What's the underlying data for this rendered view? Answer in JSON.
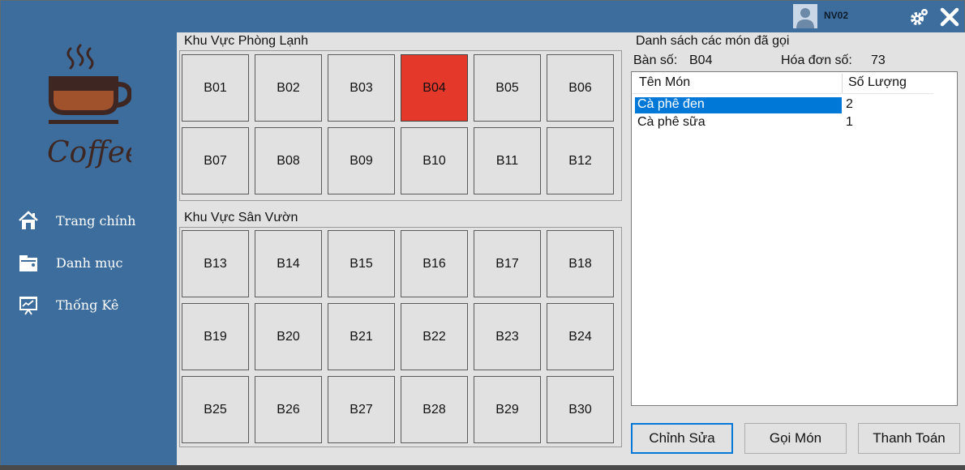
{
  "header": {
    "user_name": "NV02",
    "icons": [
      "user-avatar-icon",
      "settings-gears-icon",
      "close-icon"
    ]
  },
  "sidebar": {
    "logo_text": "Coffee",
    "items": [
      {
        "label": "Trang chính",
        "icon": "home-icon"
      },
      {
        "label": "Danh mục",
        "icon": "folder-icon"
      },
      {
        "label": "Thống Kê",
        "icon": "presentation-chart-icon"
      }
    ]
  },
  "areas": [
    {
      "title": "Khu Vực Phòng Lạnh",
      "tables": [
        "B01",
        "B02",
        "B03",
        "B04",
        "B05",
        "B06",
        "B07",
        "B08",
        "B09",
        "B10",
        "B11",
        "B12"
      ]
    },
    {
      "title": "Khu Vực Sân Vườn",
      "tables": [
        "B13",
        "B14",
        "B15",
        "B16",
        "B17",
        "B18",
        "B19",
        "B20",
        "B21",
        "B22",
        "B23",
        "B24",
        "B25",
        "B26",
        "B27",
        "B28",
        "B29",
        "B30"
      ]
    }
  ],
  "selected_table": "B04",
  "order": {
    "title": "Danh sách các món đã gọi",
    "table_label": "Bàn số:",
    "table_value": "B04",
    "invoice_label": "Hóa đơn số:",
    "invoice_value": "73",
    "columns": [
      "Tên Món",
      "Số Lượng"
    ],
    "items": [
      {
        "name": "Cà phê đen",
        "qty": "2",
        "selected": true
      },
      {
        "name": "Cà phê sữa",
        "qty": "1",
        "selected": false
      }
    ]
  },
  "actions": {
    "edit_label": "Chỉnh Sửa",
    "order_label": "Gọi Món",
    "pay_label": "Thanh Toán"
  },
  "colors": {
    "sidebar_bg": "#3c6d9d",
    "selected_table": "#e4392a",
    "selection_blue": "#0078d7",
    "logo_brown": "#3e2723",
    "logo_coffee": "#a0522d"
  }
}
